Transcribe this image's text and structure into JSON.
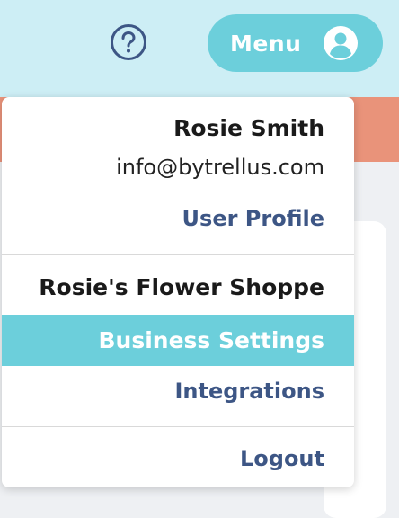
{
  "header": {
    "help_icon": "question-circle-icon",
    "menu_label": "Menu",
    "avatar_icon": "user-circle-icon"
  },
  "dropdown": {
    "user_name": "Rosie Smith",
    "user_email": "info@bytrellus.com",
    "profile_label": "User Profile",
    "business_name": "Rosie's Flower Shoppe",
    "business_settings_label": "Business Settings",
    "integrations_label": "Integrations",
    "logout_label": "Logout"
  },
  "colors": {
    "topbar": "#cdeef5",
    "accent": "#6ccfdb",
    "salmon": "#e9937a",
    "link": "#3d5685"
  }
}
